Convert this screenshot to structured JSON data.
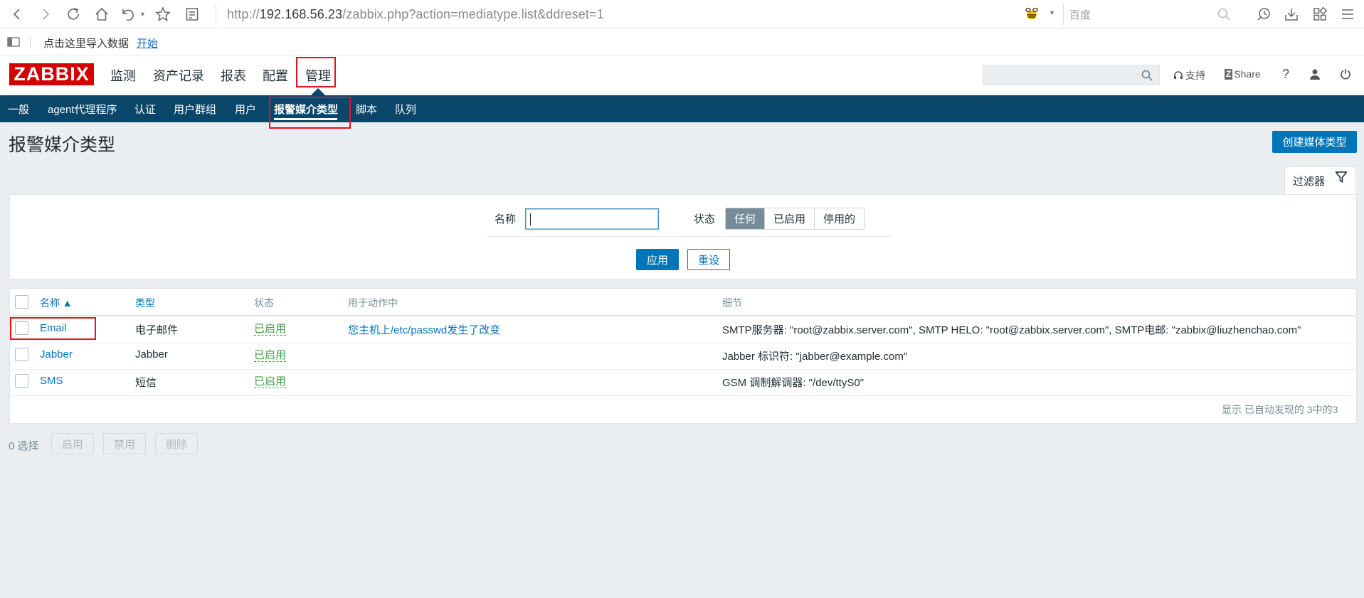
{
  "browser": {
    "url_prefix": "http://",
    "url_host": "192.168.56.23",
    "url_path": "/zabbix.php?action=mediatype.list&ddreset=1",
    "search_placeholder": "百度",
    "bookmark_text": "点击这里导入数据",
    "bookmark_link": "开始"
  },
  "header": {
    "logo": "ZABBIX",
    "menu": [
      "监测",
      "资产记录",
      "报表",
      "配置",
      "管理"
    ],
    "support": "支持",
    "share_badge": "Z",
    "share": "Share",
    "help": "?"
  },
  "subnav": [
    "一般",
    "agent代理程序",
    "认证",
    "用户群组",
    "用户",
    "报警媒介类型",
    "脚本",
    "队列"
  ],
  "page": {
    "title": "报警媒介类型",
    "create_button": "创建媒体类型"
  },
  "filter": {
    "tab_label": "过滤器",
    "name_label": "名称",
    "name_value": "",
    "status_label": "状态",
    "status_options": [
      "任何",
      "已启用",
      "停用的"
    ],
    "status_selected": "任何",
    "apply": "应用",
    "reset": "重设"
  },
  "table": {
    "columns": [
      "名称 ▲",
      "类型",
      "状态",
      "用于动作中",
      "细节"
    ],
    "rows": [
      {
        "name": "Email",
        "type": "电子邮件",
        "status": "已启用",
        "used_in": "您主机上/etc/passwd发生了改变",
        "details": "SMTP服务器: \"root@zabbix.server.com\", SMTP HELO: \"root@zabbix.server.com\", SMTP电邮: \"zabbix@liuzhenchao.com\""
      },
      {
        "name": "Jabber",
        "type": "Jabber",
        "status": "已启用",
        "used_in": "",
        "details": "Jabber 标识符: \"jabber@example.com\""
      },
      {
        "name": "SMS",
        "type": "短信",
        "status": "已启用",
        "used_in": "",
        "details": "GSM 调制解调器: \"/dev/ttyS0\""
      }
    ],
    "footer": "显示 已自动发现的 3中的3"
  },
  "actions": {
    "selected": "0 选择",
    "enable": "启用",
    "disable": "禁用",
    "delete": "删除"
  },
  "colors": {
    "nav_bg": "#0a466a",
    "primary": "#0275b8",
    "status_enabled": "#429e47",
    "logo_red": "#d40000",
    "highlight_red": "#e3141a"
  },
  "icons": [
    "back-icon",
    "forward-icon",
    "reload-icon",
    "home-icon",
    "undo-icon",
    "star-icon",
    "reader-icon",
    "search-engine-icon",
    "browser-search-icon",
    "history-icon",
    "download-icon",
    "apps-icon",
    "menu-icon",
    "sidebar-toggle-icon",
    "search-icon",
    "headset-icon",
    "user-icon",
    "power-icon",
    "filter-icon"
  ]
}
